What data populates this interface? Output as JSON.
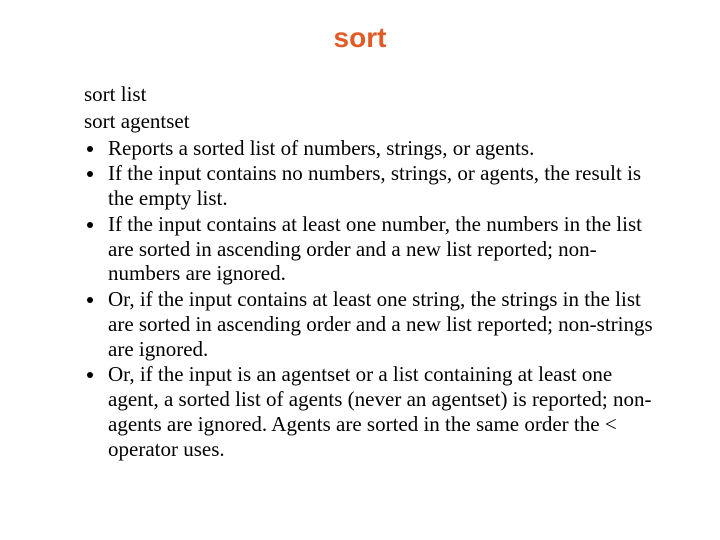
{
  "title": "sort",
  "syntax": {
    "line1": "sort list",
    "line2": "sort agentset"
  },
  "bullets": [
    "Reports a sorted list of numbers, strings, or agents.",
    "If the input contains no numbers, strings, or agents, the result is the empty list.",
    "If the input contains at least one number, the numbers in the list are sorted in ascending order and a new list reported; non-numbers are ignored.",
    "Or, if the input contains at least one string, the strings in the list are sorted in ascending order and a new list reported; non-strings are ignored.",
    "Or, if the input is an agentset or a list containing at least one agent, a sorted list of agents (never an agentset) is reported; non-agents are ignored. Agents are sorted in the same order the < operator uses."
  ]
}
